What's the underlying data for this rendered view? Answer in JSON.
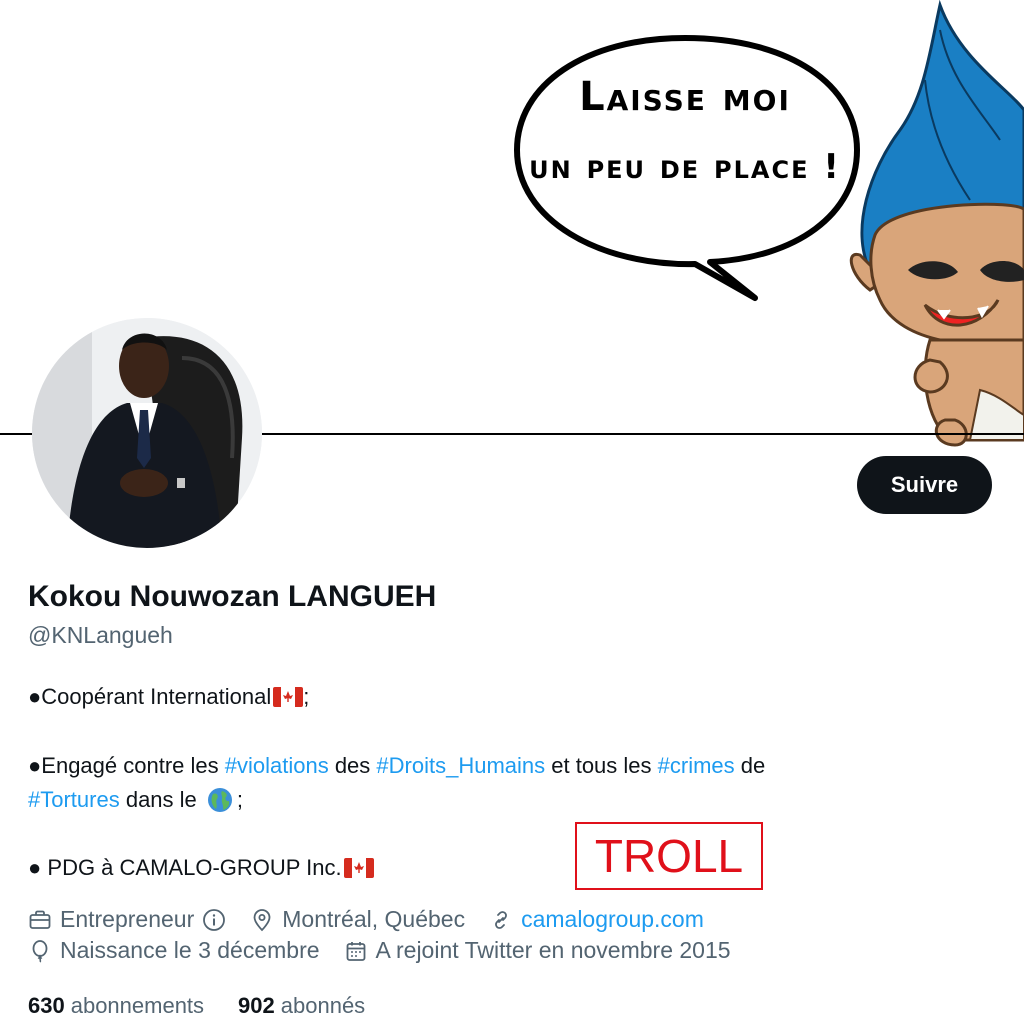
{
  "bubble": {
    "line1": "Laisse moi",
    "line2": "un peu de place !"
  },
  "profile": {
    "name": "Kokou Nouwozan LANGUEH",
    "handle": "@KNLangueh",
    "follow_label": "Suivre"
  },
  "bio": {
    "line1_text": "●Coopérant International",
    "line1_suffix": ";",
    "line2_a": "●Engagé contre les ",
    "line2_tag1": "#violations",
    "line2_b": " des ",
    "line2_tag2": "#Droits_Humains",
    "line2_c": " et tous les ",
    "line2_tag3": "#crimes",
    "line2_d": " de",
    "line2_tag4": "#Tortures",
    "line2_e": " dans le ",
    "line2_suffix": ";",
    "line3_text": "● PDG à CAMALO-GROUP  Inc."
  },
  "stamp": {
    "label": "TROLL"
  },
  "meta": {
    "profession": "Entrepreneur",
    "location": "Montréal, Québec",
    "website": "camalogroup.com",
    "birthday": "Naissance le 3 décembre",
    "joined": "A rejoint Twitter en novembre 2015"
  },
  "stats": {
    "following_count": "630",
    "following_label": "abonnements",
    "followers_count": "902",
    "followers_label": "abonnés"
  },
  "colors": {
    "accent": "#1d9bf0",
    "text": "#0f1419",
    "muted": "#536471",
    "stamp": "#e0101a",
    "troll_hair": "#1a7fc4"
  }
}
